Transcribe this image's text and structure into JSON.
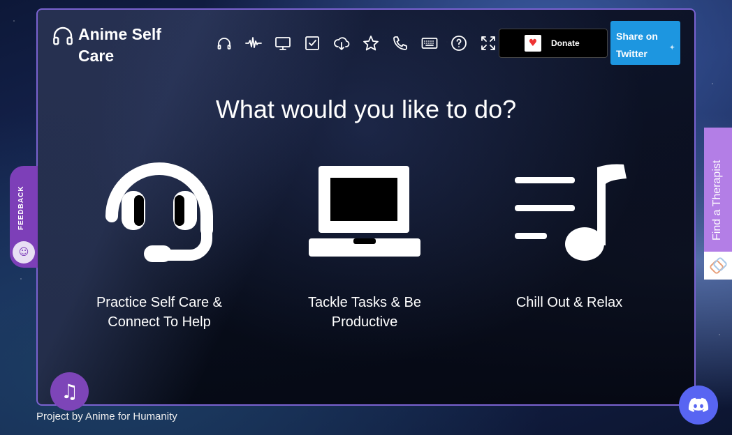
{
  "app": {
    "title": "Anime Self Care"
  },
  "toolbar": {
    "icons": [
      "headphones-icon",
      "waveform-icon",
      "monitor-icon",
      "checkbox-icon",
      "cloud-download-icon",
      "star-icon",
      "phone-icon",
      "keyboard-icon",
      "help-icon",
      "fullscreen-icon"
    ],
    "donate_label": "Donate",
    "share_label": "Share on Twitter"
  },
  "main": {
    "heading": "What would you like to do?",
    "options": [
      {
        "icon": "headset-icon",
        "label": "Practice Self Care & Connect To Help"
      },
      {
        "icon": "laptop-icon",
        "label": "Tackle Tasks & Be Productive"
      },
      {
        "icon": "playlist-music-icon",
        "label": "Chill Out & Relax"
      }
    ]
  },
  "side": {
    "feedback_label": "FEEDBACK",
    "therapist_label": "Find a Therapist"
  },
  "footer": {
    "credit": "Project by Anime for Humanity"
  },
  "colors": {
    "accent_purple": "#7d45b8",
    "therapist_purple": "#b37ee6",
    "twitter_blue": "#1d96e0",
    "discord_blue": "#5865f2"
  }
}
